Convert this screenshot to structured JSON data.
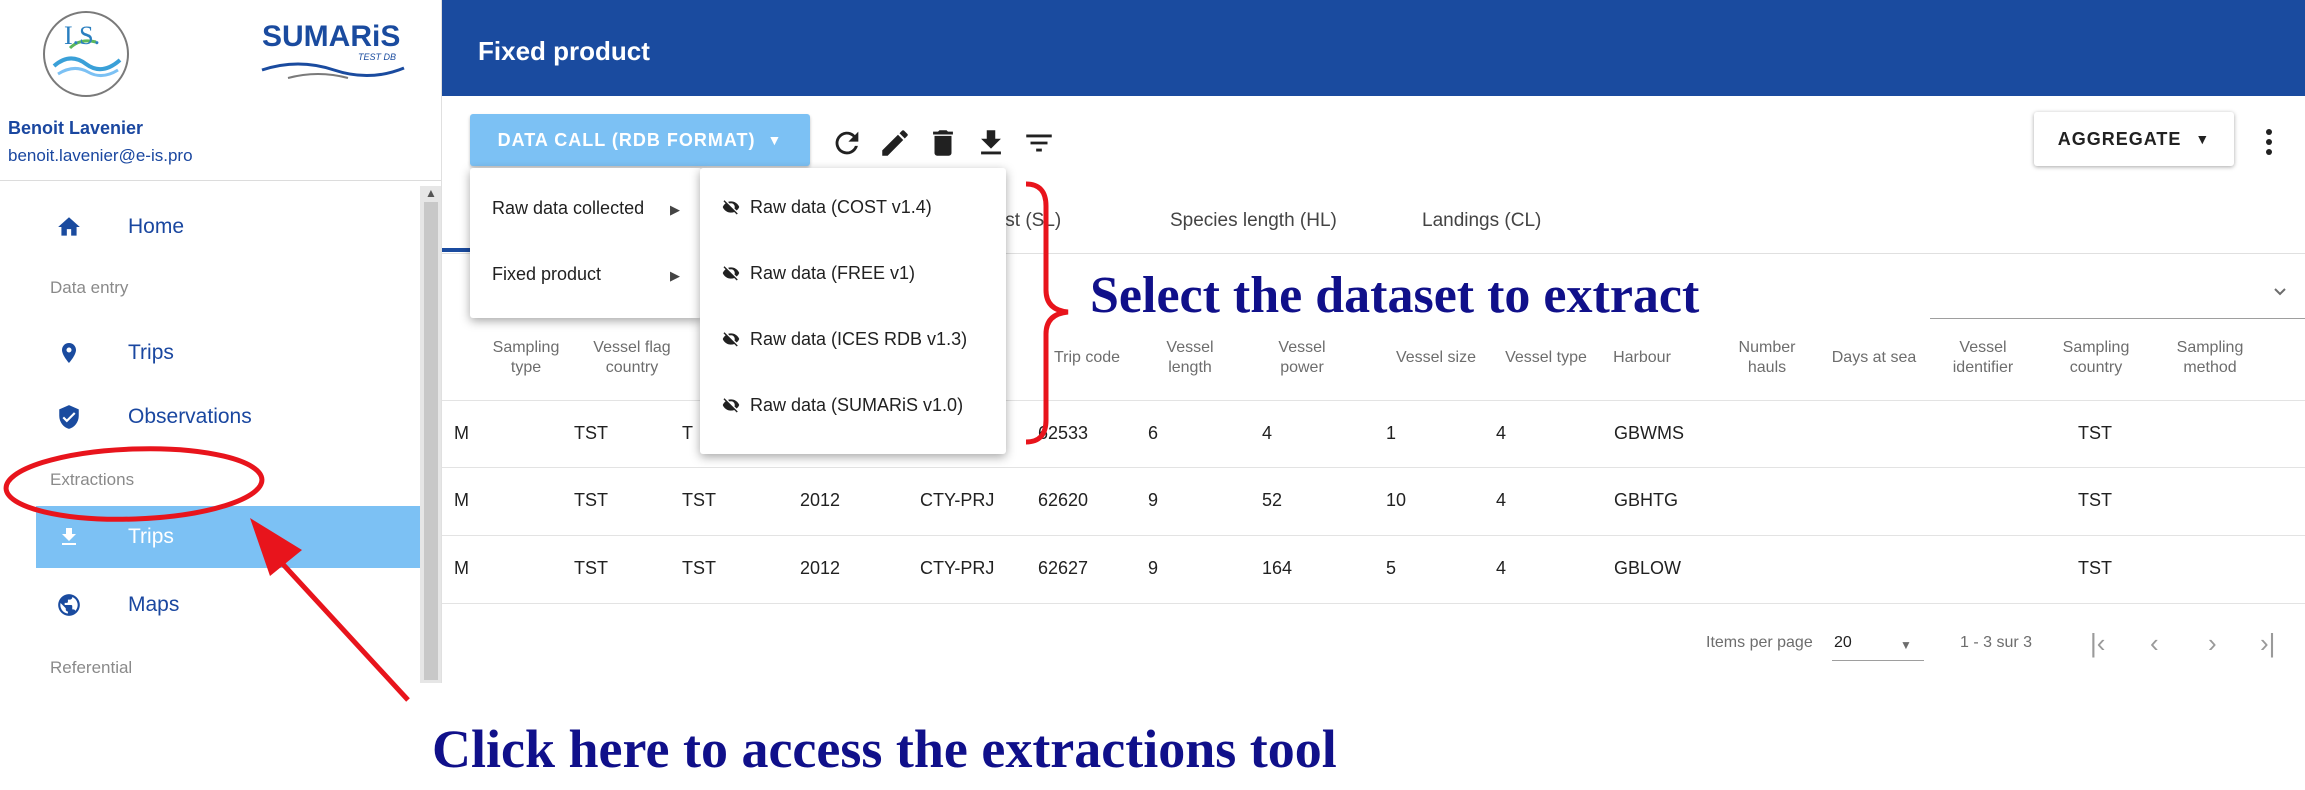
{
  "app": {
    "brand_isi": "I.S.",
    "brand_sumaris": "SUMARiS",
    "brand_sumaris_tag": "TEST DB"
  },
  "user": {
    "name": "Benoit Lavenier",
    "email": "benoit.lavenier@e-is.pro"
  },
  "sidebar": {
    "home": "Home",
    "section_data_entry": "Data entry",
    "trips": "Trips",
    "observations": "Observations",
    "section_extractions": "Extractions",
    "extraction_trips": "Trips",
    "maps": "Maps",
    "section_referential": "Referential"
  },
  "header": {
    "title": "Fixed product"
  },
  "toolbar": {
    "datacall_label": "DATA CALL (RDB FORMAT)",
    "aggregate_label": "AGGREGATE",
    "icons": [
      "refresh-icon",
      "edit-icon",
      "delete-icon",
      "download-icon",
      "filter-icon"
    ]
  },
  "tabs": {
    "species_list": "Species list (SL)",
    "species_list_visible": "cies  ist (SL)",
    "species_length": "Species length (HL)",
    "landings": "Landings (CL)"
  },
  "menu_level1": [
    {
      "label": "Raw data collected"
    },
    {
      "label": "Fixed product"
    }
  ],
  "menu_level2": [
    {
      "label": "Raw data (COST v1.4)"
    },
    {
      "label": "Raw data (FREE v1)"
    },
    {
      "label": "Raw data (ICES RDB v1.3)"
    },
    {
      "label": "Raw data (SUMARiS v1.0)"
    }
  ],
  "table": {
    "headers": {
      "sampling_type": [
        "Sampling",
        "type"
      ],
      "vessel_flag_country": [
        "Vessel flag",
        "country"
      ],
      "trip_code": [
        "Trip code"
      ],
      "vessel_length": [
        "Vessel",
        "length"
      ],
      "vessel_power": [
        "Vessel",
        "power"
      ],
      "vessel_size": [
        "Vessel size"
      ],
      "vessel_type": [
        "Vessel type"
      ],
      "harbour": [
        "Harbour"
      ],
      "number_hauls": [
        "Number",
        "hauls"
      ],
      "days_at_sea": [
        "Days at sea"
      ],
      "vessel_identifier": [
        "Vessel",
        "identifier"
      ],
      "sampling_country": [
        "Sampling",
        "country"
      ],
      "sampling_method": [
        "Sampling",
        "method"
      ]
    },
    "rows": [
      {
        "c1": "M",
        "c2": "TST",
        "c3": "T",
        "c4": "",
        "c5": "",
        "trip": "62533",
        "len": "6",
        "pow": "4",
        "size": "1",
        "type": "4",
        "harbour": "GBWMS",
        "country": "TST"
      },
      {
        "c1": "M",
        "c2": "TST",
        "c3": "TST",
        "c4": "2012",
        "c5": "CTY-PRJ",
        "trip": "62620",
        "len": "9",
        "pow": "52",
        "size": "10",
        "type": "4",
        "harbour": "GBHTG",
        "country": "TST"
      },
      {
        "c1": "M",
        "c2": "TST",
        "c3": "TST",
        "c4": "2012",
        "c5": "CTY-PRJ",
        "trip": "62627",
        "len": "9",
        "pow": "164",
        "size": "5",
        "type": "4",
        "harbour": "GBLOW",
        "country": "TST"
      }
    ]
  },
  "paginator": {
    "items_per_page_label": "Items per page",
    "page_size": "20",
    "range_label": "1 - 3 sur 3"
  },
  "annotations": {
    "select_dataset": "Select the dataset to extract",
    "click_here": "Click here to access the extractions tool"
  },
  "colors": {
    "header_blue": "#1a4b9f",
    "accent_light_blue": "#7cc1f4",
    "nav_text_blue": "#1a47a0",
    "annotation_navy": "#10108a",
    "annotation_red": "#e8141c"
  }
}
